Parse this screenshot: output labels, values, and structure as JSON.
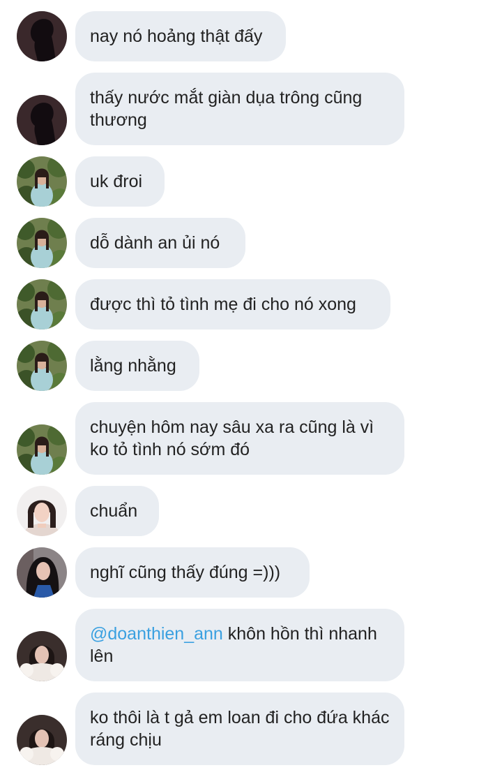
{
  "colors": {
    "bubble_bg": "#e9edf2",
    "text": "#222222",
    "mention": "#3aa0e0",
    "background": "#ffffff"
  },
  "messages": [
    {
      "avatar": "silhouette-woman-avatar",
      "text": "nay nó hoảng thật đấy"
    },
    {
      "avatar": "silhouette-woman-avatar",
      "text": "thấy nước mắt giàn dụa trông cũng thương"
    },
    {
      "avatar": "girl-in-garden-avatar",
      "text": "uk đroi"
    },
    {
      "avatar": "girl-in-garden-avatar",
      "text": "dỗ dành an ủi nó"
    },
    {
      "avatar": "girl-in-garden-avatar",
      "text": "được thì tỏ tình mẹ đi cho nó xong"
    },
    {
      "avatar": "girl-in-garden-avatar",
      "text": "lằng nhằng"
    },
    {
      "avatar": "girl-in-garden-avatar",
      "text": "chuyện hôm nay sâu xa ra cũng là vì ko tỏ tình nó sớm đó"
    },
    {
      "avatar": "girl-portrait-avatar",
      "text": "chuẩn"
    },
    {
      "avatar": "girl-dark-hair-avatar",
      "text": "nghĩ cũng thấy đúng =)))"
    },
    {
      "avatar": "girl-fur-coat-avatar",
      "mention": "@doanthien_ann",
      "text": " khôn hồn thì nhanh lên"
    },
    {
      "avatar": "girl-fur-coat-avatar",
      "text": "ko thôi là t gả em loan đi cho đứa khác ráng chịu"
    }
  ]
}
